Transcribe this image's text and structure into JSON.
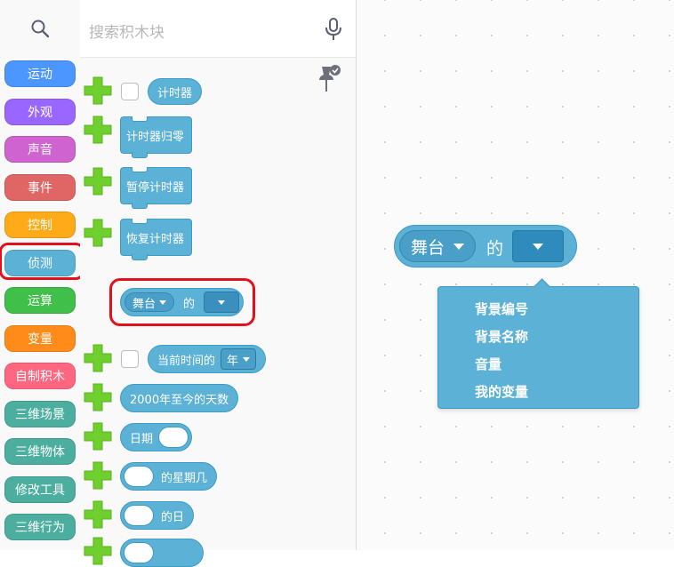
{
  "categories": [
    {
      "label": "运动",
      "color": "#4c97ff"
    },
    {
      "label": "外观",
      "color": "#9966ff"
    },
    {
      "label": "声音",
      "color": "#cf63cf"
    },
    {
      "label": "事件",
      "color": "#e06666"
    },
    {
      "label": "控制",
      "color": "#ffab19"
    },
    {
      "label": "侦测",
      "color": "#5cb1d6"
    },
    {
      "label": "运算",
      "color": "#40bf4a"
    },
    {
      "label": "变量",
      "color": "#ff8c1a"
    },
    {
      "label": "自制积木",
      "color": "#ff6680"
    },
    {
      "label": "三维场景",
      "color": "#4cae9f"
    },
    {
      "label": "三维物体",
      "color": "#4cae9f"
    },
    {
      "label": "修改工具",
      "color": "#4cae9f"
    },
    {
      "label": "三维行为",
      "color": "#4cae9f"
    }
  ],
  "search": {
    "placeholder": "搜索积木块"
  },
  "blocks": {
    "timer": "计时器",
    "reset_timer": "计时器归零",
    "pause_timer": "暂停计时器",
    "resume_timer": "恢复计时器",
    "of_stage": "舞台",
    "of_label": "的",
    "current_time": "当前时间的",
    "current_time_unit": "年",
    "days_since_2000": "2000年至今的天数",
    "date": "日期",
    "weekday": "的星期几",
    "day": "的日"
  },
  "workspace": {
    "block_target": "舞台",
    "block_of": "的",
    "menu_items": [
      "背景编号",
      "背景名称",
      "音量",
      "我的变量"
    ]
  },
  "colors": {
    "sensing": "#5cb1d6",
    "highlight": "#e3101c",
    "plus": "#6fcf2e"
  }
}
